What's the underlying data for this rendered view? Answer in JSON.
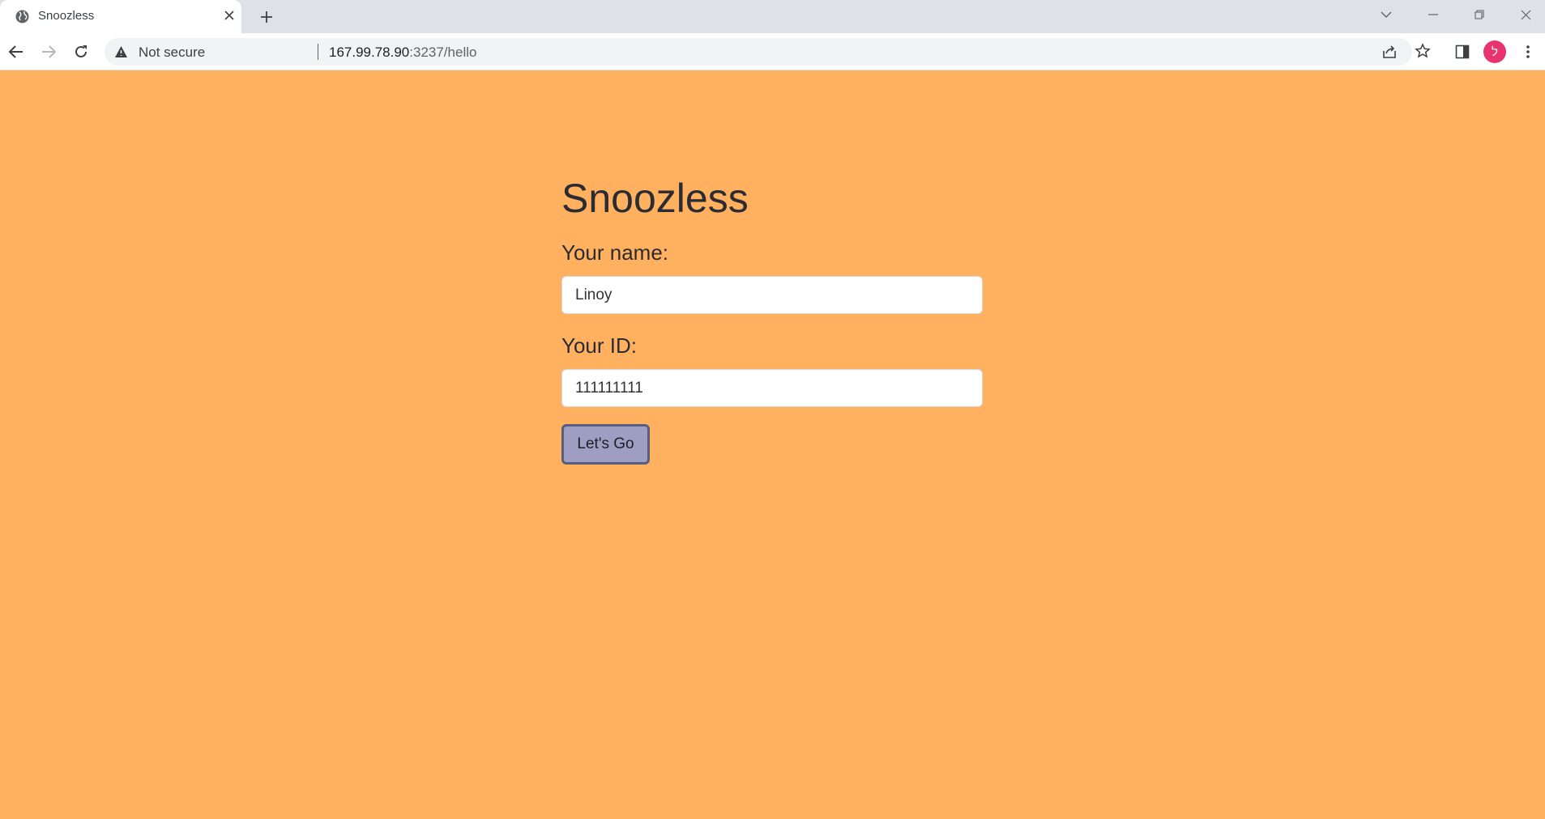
{
  "browser": {
    "tab_title": "Snoozless",
    "security_label": "Not secure",
    "url_host": "167.99.78.90",
    "url_rest": ":3237/hello",
    "profile_initial": "ל"
  },
  "app": {
    "title": "Snoozless",
    "name_label": "Your name:",
    "name_value": "Linoy",
    "id_label": "Your ID:",
    "id_value": "111111111",
    "submit_label": "Let's Go"
  },
  "colors": {
    "page_background": "#ffb160",
    "button_background": "#9e9dc2",
    "button_border": "#5a5e7e",
    "avatar": "#e8336e"
  }
}
